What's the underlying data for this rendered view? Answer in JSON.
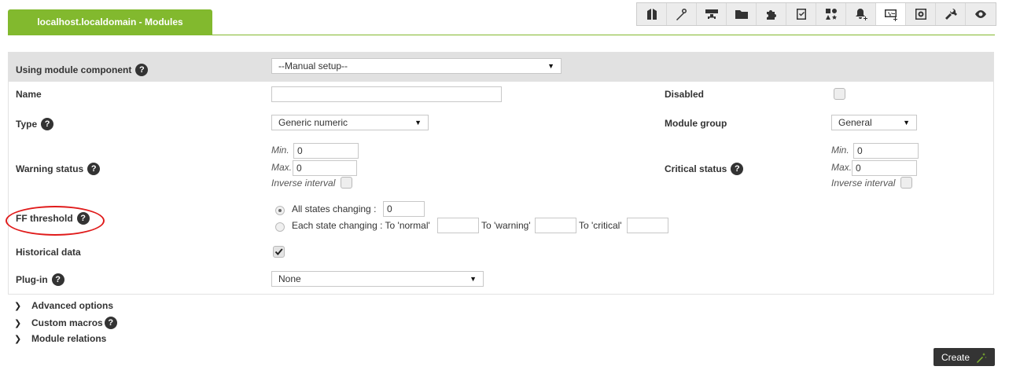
{
  "header": {
    "title": "localhost.localdomain - Modules",
    "toolbar_icons": [
      "manage-icon",
      "wand-icon",
      "network-icon",
      "folder-icon",
      "puzzle-icon",
      "checklist-icon",
      "shapes-icon",
      "bell-icon",
      "pulse-monitor-icon",
      "gear-box-icon",
      "tools-icon",
      "eye-icon"
    ],
    "active_toolbar_index": 8
  },
  "form": {
    "component": {
      "label": "Using module component",
      "value": "--Manual setup--"
    },
    "name": {
      "label": "Name",
      "value": ""
    },
    "disabled": {
      "label": "Disabled",
      "checked": false
    },
    "type": {
      "label": "Type",
      "value": "Generic numeric"
    },
    "module_group": {
      "label": "Module group",
      "value": "General"
    },
    "warning": {
      "label": "Warning status",
      "min_label": "Min.",
      "min_value": "0",
      "max_label": "Max.",
      "max_value": "0",
      "inverse_label": "Inverse interval",
      "inverse_checked": false
    },
    "critical": {
      "label": "Critical status",
      "min_label": "Min.",
      "min_value": "0",
      "max_label": "Max.",
      "max_value": "0",
      "inverse_label": "Inverse interval",
      "inverse_checked": false
    },
    "ff_threshold": {
      "label": "FF threshold",
      "all_label": "All states changing :",
      "all_value": "0",
      "each_label": "Each state changing : To 'normal'",
      "to_warning_label": "To 'warning'",
      "to_critical_label": "To 'critical'",
      "normal_value": "",
      "warning_value": "",
      "critical_value": "",
      "selected": "all"
    },
    "historical": {
      "label": "Historical data",
      "checked": true
    },
    "plugin": {
      "label": "Plug-in",
      "value": "None"
    }
  },
  "sections": {
    "advanced": "Advanced options",
    "macros": "Custom macros",
    "relations": "Module relations"
  },
  "actions": {
    "create_label": "Create"
  },
  "colors": {
    "accent": "#82b92e",
    "dark_button": "#343434",
    "annotation": "#e01b1b"
  }
}
